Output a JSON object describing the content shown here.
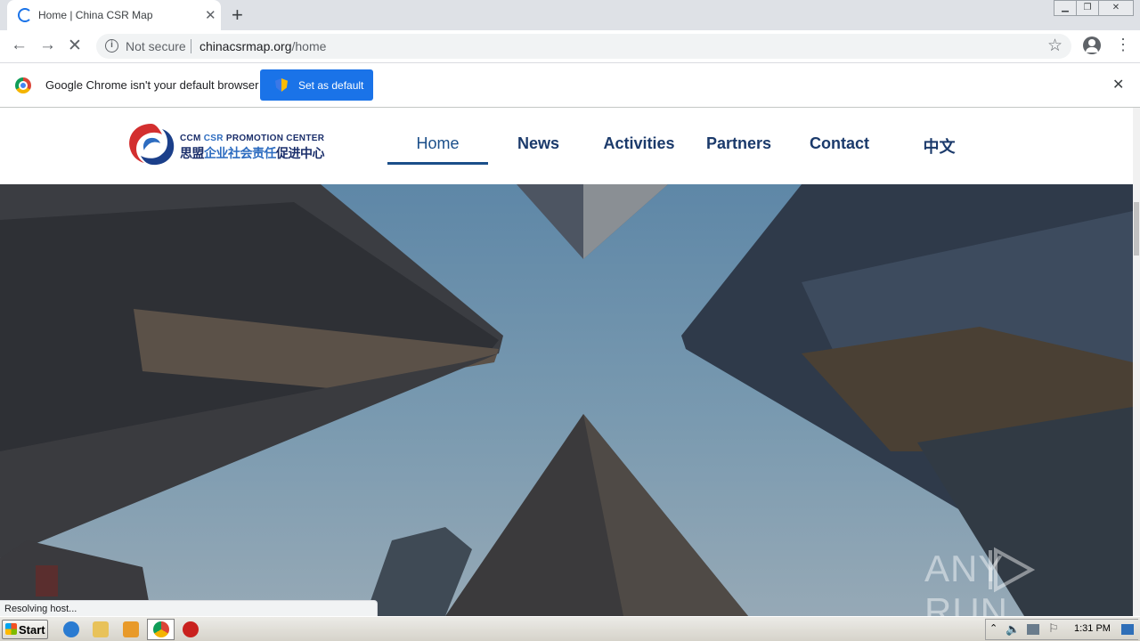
{
  "browser": {
    "tab_title": "Home | China CSR Map",
    "new_tab_symbol": "+",
    "tab_close_symbol": "✕",
    "security_label": "Not secure",
    "url_domain": "chinacsrmap.org",
    "url_path": "/home",
    "infobar_message": "Google Chrome isn't your default browser",
    "set_default_label": "Set as default",
    "status_text": "Resolving host..."
  },
  "site": {
    "logo_line1_a": "CCM ",
    "logo_line1_b": "CSR",
    "logo_line1_c": " PROMOTION CENTER",
    "logo_line2_a": "思盟",
    "logo_line2_b": "企业社会责任",
    "logo_line2_c": "促进中心",
    "nav": {
      "home": "Home",
      "news": "News",
      "activities": "Activities",
      "partners": "Partners",
      "contact": "Contact",
      "chinese": "中文"
    },
    "active_nav": "Home"
  },
  "watermark": {
    "left": "ANY",
    "right": "RUN"
  },
  "taskbar": {
    "start_label": "Start",
    "clock": "1:31 PM"
  },
  "colors": {
    "accent": "#1a73e8",
    "nav_text": "#1b3a6b",
    "logo_red": "#d32f2f",
    "logo_blue": "#2d6cc0"
  }
}
